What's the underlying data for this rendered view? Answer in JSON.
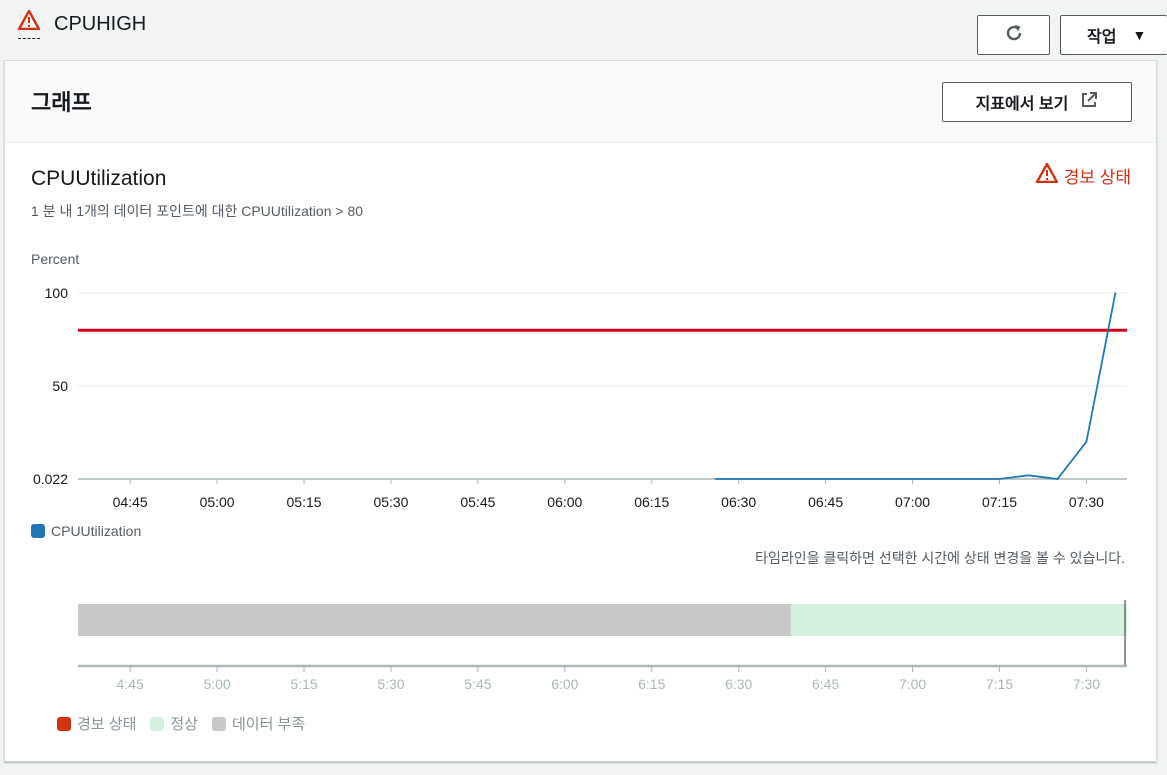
{
  "alarm": {
    "name": "CPUHIGH"
  },
  "toolbar": {
    "actions_label": "작업"
  },
  "panel": {
    "title": "그래프",
    "view_in_metrics_label": "지표에서 보기"
  },
  "chart_data": {
    "type": "line",
    "title": "CPUUtilization",
    "subtitle": "1 분 내 1개의 데이터 포인트에 대한 CPUUtilization > 80",
    "state_badge": "경보 상태",
    "ylabel": "Percent",
    "ylim": [
      0.022,
      100
    ],
    "y_ticks": [
      "100",
      "50",
      "0.022"
    ],
    "x_ticks": [
      "04:45",
      "05:00",
      "05:15",
      "05:30",
      "05:45",
      "06:00",
      "06:15",
      "06:30",
      "06:45",
      "07:00",
      "07:15",
      "07:30"
    ],
    "threshold": 80,
    "threshold_color": "#d0021b",
    "series": [
      {
        "name": "CPUUtilization",
        "color": "#1f77b4",
        "x": [
          "06:26",
          "06:30",
          "06:35",
          "06:40",
          "06:45",
          "06:50",
          "06:55",
          "07:00",
          "07:05",
          "07:10",
          "07:15",
          "07:20",
          "07:25",
          "07:30",
          "07:35"
        ],
        "values": [
          0.022,
          0.022,
          0.022,
          0.022,
          0.022,
          0.022,
          0.022,
          0.022,
          0.022,
          0.022,
          0.022,
          2,
          0.022,
          20,
          100
        ]
      }
    ],
    "grid": true
  },
  "timeline": {
    "hint": "타임라인을 클릭하면 선택한 시간에 상태 변경을 볼 수 있습니다.",
    "ticks": [
      "4:45",
      "5:00",
      "5:15",
      "5:30",
      "5:45",
      "6:00",
      "6:15",
      "6:30",
      "6:45",
      "7:00",
      "7:15",
      "7:30"
    ],
    "segments": [
      {
        "state": "데이터 부족",
        "start": "04:36",
        "end": "06:39",
        "color": "#c8c8c8"
      },
      {
        "state": "정상",
        "start": "06:39",
        "end": "07:37",
        "color": "#d4f1e0"
      }
    ],
    "legend": [
      {
        "label": "경보 상태",
        "color": "#d13212"
      },
      {
        "label": "정상",
        "color": "#d4f1e0"
      },
      {
        "label": "데이터 부족",
        "color": "#c8c8c8"
      }
    ]
  }
}
